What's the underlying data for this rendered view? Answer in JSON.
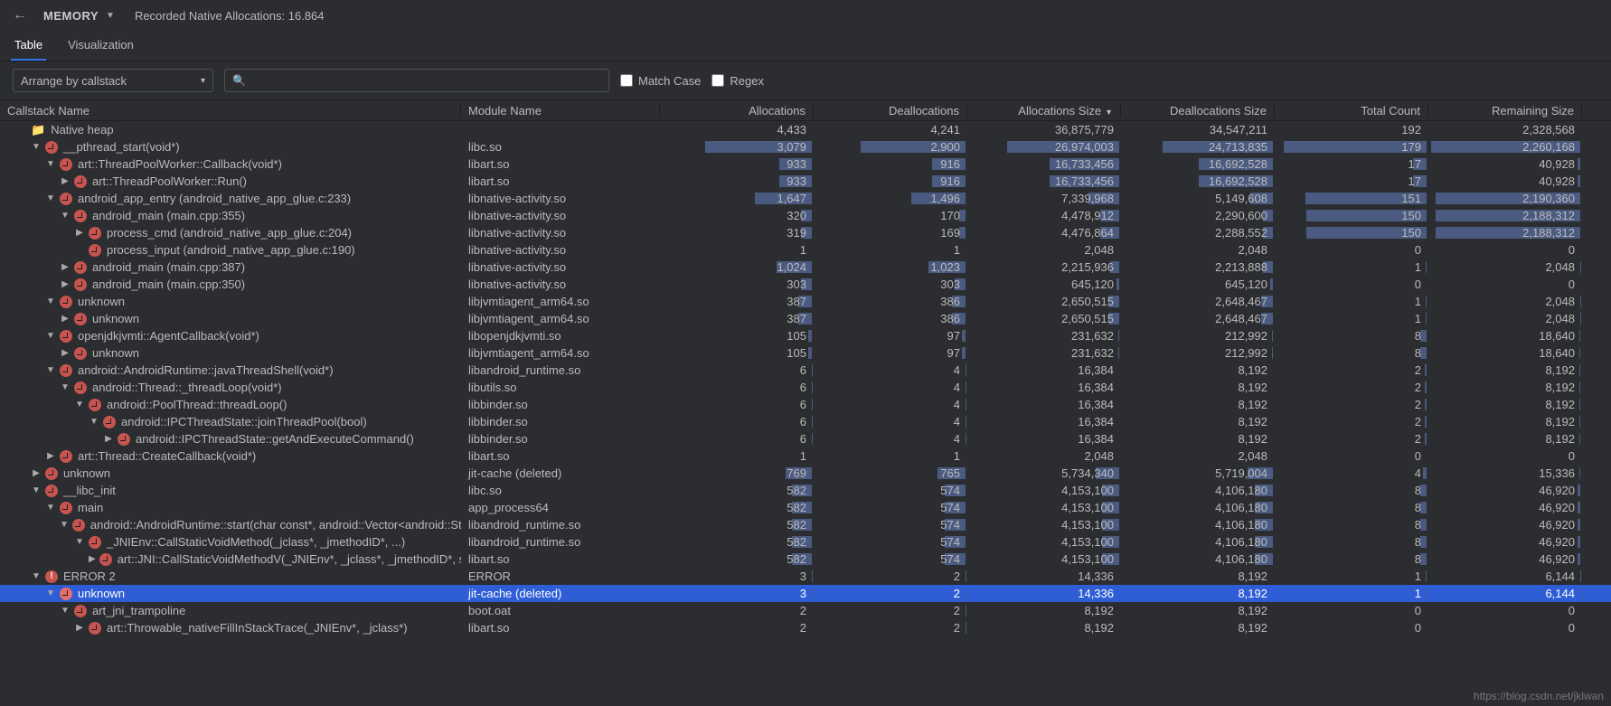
{
  "header": {
    "section": "MEMORY",
    "recording_label": "Recorded Native Allocations: 16.864"
  },
  "tabs": {
    "table": "Table",
    "visualization": "Visualization"
  },
  "filter": {
    "arrange_label": "Arrange by callstack",
    "match_case": "Match Case",
    "regex": "Regex"
  },
  "columns": {
    "callstack": "Callstack Name",
    "module": "Module Name",
    "allocs": "Allocations",
    "deallocs": "Deallocations",
    "alloc_size": "Allocations Size",
    "dealloc_size": "Deallocations Size",
    "total_count": "Total Count",
    "remain_size": "Remaining Size"
  },
  "bar_max": {
    "allocs": 4433,
    "deallocs": 4241,
    "alloc_size": 36875779,
    "dealloc_size": 34547211,
    "total_count": 192,
    "remain_size": 2328568
  },
  "rows": [
    {
      "indent": 0,
      "arrow": "",
      "icon": "folder",
      "name": "Native heap",
      "module": "",
      "allocs": "4,433",
      "deallocs": "4,241",
      "alloc_size": "36,875,779",
      "dealloc_size": "34,547,211",
      "total_count": "192",
      "remain_size": "2,328,568",
      "r": [
        4433,
        4241,
        36875779,
        34547211,
        192,
        2328568
      ],
      "nobar": true
    },
    {
      "indent": 1,
      "arrow": "down",
      "icon": "clock",
      "name": "__pthread_start(void*)",
      "module": "libc.so",
      "allocs": "3,079",
      "deallocs": "2,900",
      "alloc_size": "26,974,003",
      "dealloc_size": "24,713,835",
      "total_count": "179",
      "remain_size": "2,260,168",
      "r": [
        3079,
        2900,
        26974003,
        24713835,
        179,
        2260168
      ]
    },
    {
      "indent": 2,
      "arrow": "down",
      "icon": "clock",
      "name": "art::ThreadPoolWorker::Callback(void*)",
      "module": "libart.so",
      "allocs": "933",
      "deallocs": "916",
      "alloc_size": "16,733,456",
      "dealloc_size": "16,692,528",
      "total_count": "17",
      "remain_size": "40,928",
      "r": [
        933,
        916,
        16733456,
        16692528,
        17,
        40928
      ]
    },
    {
      "indent": 3,
      "arrow": "right",
      "icon": "clock",
      "name": "art::ThreadPoolWorker::Run()",
      "module": "libart.so",
      "allocs": "933",
      "deallocs": "916",
      "alloc_size": "16,733,456",
      "dealloc_size": "16,692,528",
      "total_count": "17",
      "remain_size": "40,928",
      "r": [
        933,
        916,
        16733456,
        16692528,
        17,
        40928
      ]
    },
    {
      "indent": 2,
      "arrow": "down",
      "icon": "clock",
      "name": "android_app_entry (android_native_app_glue.c:233)",
      "module": "libnative-activity.so",
      "allocs": "1,647",
      "deallocs": "1,496",
      "alloc_size": "7,339,968",
      "dealloc_size": "5,149,608",
      "total_count": "151",
      "remain_size": "2,190,360",
      "r": [
        1647,
        1496,
        7339968,
        5149608,
        151,
        2190360
      ]
    },
    {
      "indent": 3,
      "arrow": "down",
      "icon": "clock",
      "name": "android_main (main.cpp:355)",
      "module": "libnative-activity.so",
      "allocs": "320",
      "deallocs": "170",
      "alloc_size": "4,478,912",
      "dealloc_size": "2,290,600",
      "total_count": "150",
      "remain_size": "2,188,312",
      "r": [
        320,
        170,
        4478912,
        2290600,
        150,
        2188312
      ]
    },
    {
      "indent": 4,
      "arrow": "right",
      "icon": "clock",
      "name": "process_cmd (android_native_app_glue.c:204)",
      "module": "libnative-activity.so",
      "allocs": "319",
      "deallocs": "169",
      "alloc_size": "4,476,864",
      "dealloc_size": "2,288,552",
      "total_count": "150",
      "remain_size": "2,188,312",
      "r": [
        319,
        169,
        4476864,
        2288552,
        150,
        2188312
      ]
    },
    {
      "indent": 4,
      "arrow": "none",
      "icon": "clock",
      "name": "process_input (android_native_app_glue.c:190)",
      "module": "libnative-activity.so",
      "allocs": "1",
      "deallocs": "1",
      "alloc_size": "2,048",
      "dealloc_size": "2,048",
      "total_count": "0",
      "remain_size": "0",
      "r": [
        1,
        1,
        2048,
        2048,
        0,
        0
      ]
    },
    {
      "indent": 3,
      "arrow": "right",
      "icon": "clock",
      "name": "android_main (main.cpp:387)",
      "module": "libnative-activity.so",
      "allocs": "1,024",
      "deallocs": "1,023",
      "alloc_size": "2,215,936",
      "dealloc_size": "2,213,888",
      "total_count": "1",
      "remain_size": "2,048",
      "r": [
        1024,
        1023,
        2215936,
        2213888,
        1,
        2048
      ]
    },
    {
      "indent": 3,
      "arrow": "right",
      "icon": "clock",
      "name": "android_main (main.cpp:350)",
      "module": "libnative-activity.so",
      "allocs": "303",
      "deallocs": "303",
      "alloc_size": "645,120",
      "dealloc_size": "645,120",
      "total_count": "0",
      "remain_size": "0",
      "r": [
        303,
        303,
        645120,
        645120,
        0,
        0
      ]
    },
    {
      "indent": 2,
      "arrow": "down",
      "icon": "clock",
      "name": "unknown",
      "module": "libjvmtiagent_arm64.so",
      "allocs": "387",
      "deallocs": "386",
      "alloc_size": "2,650,515",
      "dealloc_size": "2,648,467",
      "total_count": "1",
      "remain_size": "2,048",
      "r": [
        387,
        386,
        2650515,
        2648467,
        1,
        2048
      ]
    },
    {
      "indent": 3,
      "arrow": "right",
      "icon": "clock",
      "name": "unknown",
      "module": "libjvmtiagent_arm64.so",
      "allocs": "387",
      "deallocs": "386",
      "alloc_size": "2,650,515",
      "dealloc_size": "2,648,467",
      "total_count": "1",
      "remain_size": "2,048",
      "r": [
        387,
        386,
        2650515,
        2648467,
        1,
        2048
      ]
    },
    {
      "indent": 2,
      "arrow": "down",
      "icon": "clock",
      "name": "openjdkjvmti::AgentCallback(void*)",
      "module": "libopenjdkjvmti.so",
      "allocs": "105",
      "deallocs": "97",
      "alloc_size": "231,632",
      "dealloc_size": "212,992",
      "total_count": "8",
      "remain_size": "18,640",
      "r": [
        105,
        97,
        231632,
        212992,
        8,
        18640
      ]
    },
    {
      "indent": 3,
      "arrow": "right",
      "icon": "clock",
      "name": "unknown",
      "module": "libjvmtiagent_arm64.so",
      "allocs": "105",
      "deallocs": "97",
      "alloc_size": "231,632",
      "dealloc_size": "212,992",
      "total_count": "8",
      "remain_size": "18,640",
      "r": [
        105,
        97,
        231632,
        212992,
        8,
        18640
      ]
    },
    {
      "indent": 2,
      "arrow": "down",
      "icon": "clock",
      "name": "android::AndroidRuntime::javaThreadShell(void*)",
      "module": "libandroid_runtime.so",
      "allocs": "6",
      "deallocs": "4",
      "alloc_size": "16,384",
      "dealloc_size": "8,192",
      "total_count": "2",
      "remain_size": "8,192",
      "r": [
        6,
        4,
        16384,
        8192,
        2,
        8192
      ]
    },
    {
      "indent": 3,
      "arrow": "down",
      "icon": "clock",
      "name": "android::Thread::_threadLoop(void*)",
      "module": "libutils.so",
      "allocs": "6",
      "deallocs": "4",
      "alloc_size": "16,384",
      "dealloc_size": "8,192",
      "total_count": "2",
      "remain_size": "8,192",
      "r": [
        6,
        4,
        16384,
        8192,
        2,
        8192
      ]
    },
    {
      "indent": 4,
      "arrow": "down",
      "icon": "clock",
      "name": "android::PoolThread::threadLoop()",
      "module": "libbinder.so",
      "allocs": "6",
      "deallocs": "4",
      "alloc_size": "16,384",
      "dealloc_size": "8,192",
      "total_count": "2",
      "remain_size": "8,192",
      "r": [
        6,
        4,
        16384,
        8192,
        2,
        8192
      ]
    },
    {
      "indent": 5,
      "arrow": "down",
      "icon": "clock",
      "name": "android::IPCThreadState::joinThreadPool(bool)",
      "module": "libbinder.so",
      "allocs": "6",
      "deallocs": "4",
      "alloc_size": "16,384",
      "dealloc_size": "8,192",
      "total_count": "2",
      "remain_size": "8,192",
      "r": [
        6,
        4,
        16384,
        8192,
        2,
        8192
      ]
    },
    {
      "indent": 6,
      "arrow": "right",
      "icon": "clock",
      "name": "android::IPCThreadState::getAndExecuteCommand()",
      "module": "libbinder.so",
      "allocs": "6",
      "deallocs": "4",
      "alloc_size": "16,384",
      "dealloc_size": "8,192",
      "total_count": "2",
      "remain_size": "8,192",
      "r": [
        6,
        4,
        16384,
        8192,
        2,
        8192
      ]
    },
    {
      "indent": 2,
      "arrow": "right",
      "icon": "clock",
      "name": "art::Thread::CreateCallback(void*)",
      "module": "libart.so",
      "allocs": "1",
      "deallocs": "1",
      "alloc_size": "2,048",
      "dealloc_size": "2,048",
      "total_count": "0",
      "remain_size": "0",
      "r": [
        1,
        1,
        2048,
        2048,
        0,
        0
      ]
    },
    {
      "indent": 1,
      "arrow": "right",
      "icon": "clock",
      "name": "unknown",
      "module": "jit-cache (deleted)",
      "allocs": "769",
      "deallocs": "765",
      "alloc_size": "5,734,340",
      "dealloc_size": "5,719,004",
      "total_count": "4",
      "remain_size": "15,336",
      "r": [
        769,
        765,
        5734340,
        5719004,
        4,
        15336
      ]
    },
    {
      "indent": 1,
      "arrow": "down",
      "icon": "clock",
      "name": "__libc_init",
      "module": "libc.so",
      "allocs": "582",
      "deallocs": "574",
      "alloc_size": "4,153,100",
      "dealloc_size": "4,106,180",
      "total_count": "8",
      "remain_size": "46,920",
      "r": [
        582,
        574,
        4153100,
        4106180,
        8,
        46920
      ]
    },
    {
      "indent": 2,
      "arrow": "down",
      "icon": "clock",
      "name": "main",
      "module": "app_process64",
      "allocs": "582",
      "deallocs": "574",
      "alloc_size": "4,153,100",
      "dealloc_size": "4,106,180",
      "total_count": "8",
      "remain_size": "46,920",
      "r": [
        582,
        574,
        4153100,
        4106180,
        8,
        46920
      ]
    },
    {
      "indent": 3,
      "arrow": "down",
      "icon": "clock",
      "name": "android::AndroidRuntime::start(char const*, android::Vector<android::String",
      "module": "libandroid_runtime.so",
      "allocs": "582",
      "deallocs": "574",
      "alloc_size": "4,153,100",
      "dealloc_size": "4,106,180",
      "total_count": "8",
      "remain_size": "46,920",
      "r": [
        582,
        574,
        4153100,
        4106180,
        8,
        46920
      ]
    },
    {
      "indent": 4,
      "arrow": "down",
      "icon": "clock",
      "name": "_JNIEnv::CallStaticVoidMethod(_jclass*, _jmethodID*, ...)",
      "module": "libandroid_runtime.so",
      "allocs": "582",
      "deallocs": "574",
      "alloc_size": "4,153,100",
      "dealloc_size": "4,106,180",
      "total_count": "8",
      "remain_size": "46,920",
      "r": [
        582,
        574,
        4153100,
        4106180,
        8,
        46920
      ]
    },
    {
      "indent": 5,
      "arrow": "right",
      "icon": "clock",
      "name": "art::JNI::CallStaticVoidMethodV(_JNIEnv*, _jclass*, _jmethodID*, std::_",
      "module": "libart.so",
      "allocs": "582",
      "deallocs": "574",
      "alloc_size": "4,153,100",
      "dealloc_size": "4,106,180",
      "total_count": "8",
      "remain_size": "46,920",
      "r": [
        582,
        574,
        4153100,
        4106180,
        8,
        46920
      ]
    },
    {
      "indent": 1,
      "arrow": "down",
      "icon": "error",
      "name": "ERROR 2",
      "module": "ERROR",
      "allocs": "3",
      "deallocs": "2",
      "alloc_size": "14,336",
      "dealloc_size": "8,192",
      "total_count": "1",
      "remain_size": "6,144",
      "r": [
        3,
        2,
        14336,
        8192,
        1,
        6144
      ]
    },
    {
      "indent": 2,
      "arrow": "down",
      "icon": "clock",
      "name": "unknown",
      "module": "jit-cache (deleted)",
      "allocs": "3",
      "deallocs": "2",
      "alloc_size": "14,336",
      "dealloc_size": "8,192",
      "total_count": "1",
      "remain_size": "6,144",
      "r": [
        3,
        2,
        14336,
        8192,
        1,
        6144
      ],
      "selected": true
    },
    {
      "indent": 3,
      "arrow": "down",
      "icon": "clock",
      "name": "art_jni_trampoline",
      "module": "boot.oat",
      "allocs": "2",
      "deallocs": "2",
      "alloc_size": "8,192",
      "dealloc_size": "8,192",
      "total_count": "0",
      "remain_size": "0",
      "r": [
        2,
        2,
        8192,
        8192,
        0,
        0
      ]
    },
    {
      "indent": 4,
      "arrow": "right",
      "icon": "clock",
      "name": "art::Throwable_nativeFillInStackTrace(_JNIEnv*, _jclass*)",
      "module": "libart.so",
      "allocs": "2",
      "deallocs": "2",
      "alloc_size": "8,192",
      "dealloc_size": "8,192",
      "total_count": "0",
      "remain_size": "0",
      "r": [
        2,
        2,
        8192,
        8192,
        0,
        0
      ]
    }
  ],
  "watermark": "https://blog.csdn.net/jklwan"
}
